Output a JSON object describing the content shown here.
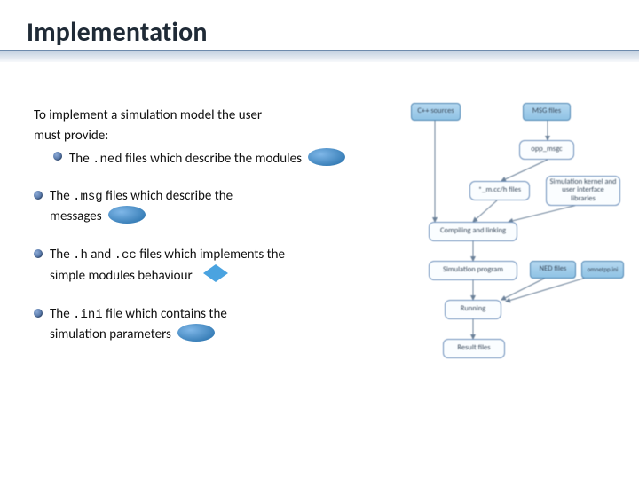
{
  "slide": {
    "title": "Implementation"
  },
  "body": {
    "intro_l1": "To implement a simulation model the user",
    "intro_l2": "must provide:",
    "b1_pre": "The ",
    "b1_code": ".ned",
    "b1_post": " files which describe the modules",
    "b2_pre": "The ",
    "b2_code": ".msg",
    "b2_post": " files which describe the",
    "b2_l2": "messages",
    "b3_pre": "The ",
    "b3_code1": ".h",
    "b3_mid": " and ",
    "b3_code2": ".cc",
    "b3_post": " files which implements the",
    "b3_l2": "simple modules behaviour",
    "b4_pre": "The ",
    "b4_code": ".ini",
    "b4_post": " file which contains the",
    "b4_l2": "simulation parameters"
  },
  "diagram": {
    "cpp_sources": "C++ sources",
    "msg_files": "MSG files",
    "opp_msgc": "opp_msgc",
    "cc_h_files": "*_m.cc/h files",
    "sim_kernel": "Simulation kernel and user interface libraries",
    "compile_link": "Compiling and linking",
    "sim_program": "Simulation program",
    "ned_files": "NED files",
    "omnetpp_ini": "omnetpp.ini",
    "running": "Running",
    "result_files": "Result files"
  }
}
